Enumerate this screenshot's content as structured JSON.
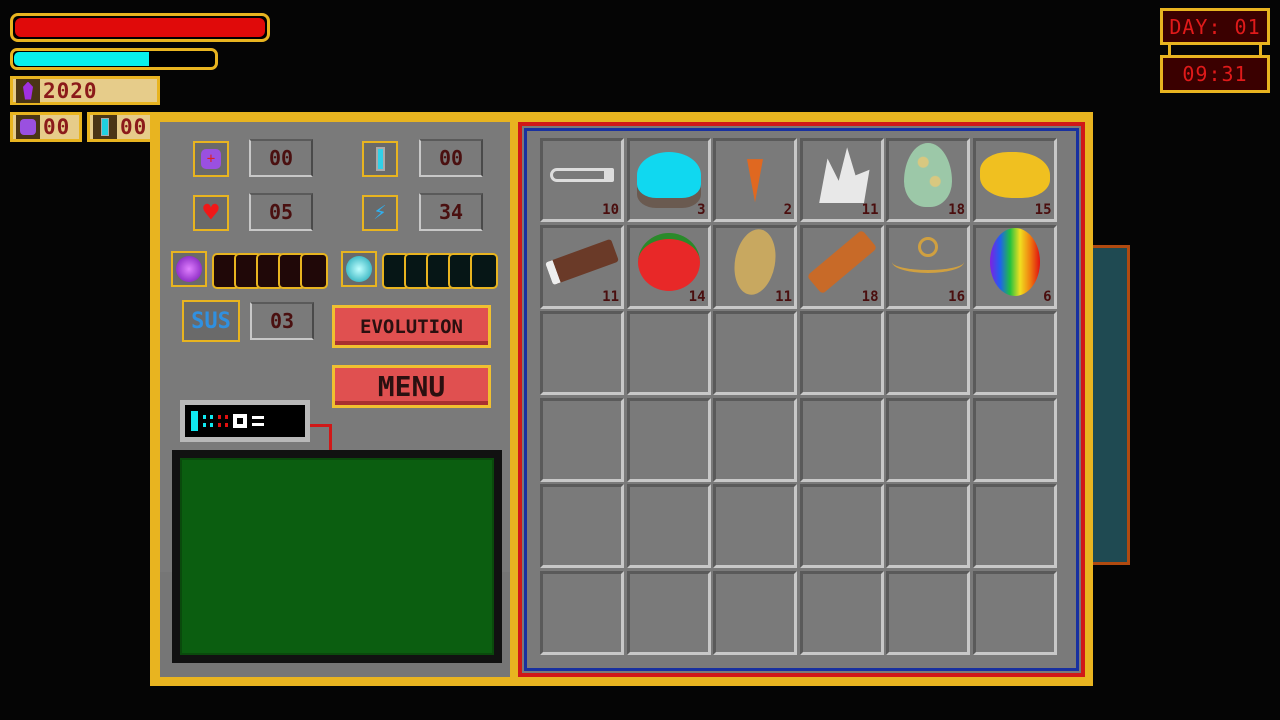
{
  "hud": {
    "health_fraction": 1.0,
    "mana_fraction": 0.67,
    "gems": "2020",
    "potions": "00",
    "vials": "00"
  },
  "clock": {
    "day": "DAY: 01",
    "time": "09:31"
  },
  "stats": {
    "potion": "00",
    "vial": "00",
    "hearts": "05",
    "energy": "34",
    "sus_label": "SUS",
    "sus": "03"
  },
  "gauges": {
    "purple_filled": 0,
    "cyan_filled": 0,
    "slots": 5
  },
  "buttons": {
    "evolution": "EVOLUTION",
    "menu": "MENU"
  },
  "inventory": [
    {
      "name": "key",
      "count": "10"
    },
    {
      "name": "cyan-slime",
      "count": "3"
    },
    {
      "name": "carrot",
      "count": "2"
    },
    {
      "name": "crystal",
      "count": "11"
    },
    {
      "name": "spotted-egg",
      "count": "18"
    },
    {
      "name": "gold-nugget",
      "count": "15"
    },
    {
      "name": "log",
      "count": "11"
    },
    {
      "name": "tomato",
      "count": "14"
    },
    {
      "name": "potato",
      "count": "11"
    },
    {
      "name": "cinnamon",
      "count": "18"
    },
    {
      "name": "rope",
      "count": "16"
    },
    {
      "name": "rainbow-egg",
      "count": "6"
    }
  ],
  "colors": {
    "gold": "#e8b420",
    "health": "#e00a0a",
    "mana": "#08f0ec",
    "screen": "#0b5e10"
  }
}
